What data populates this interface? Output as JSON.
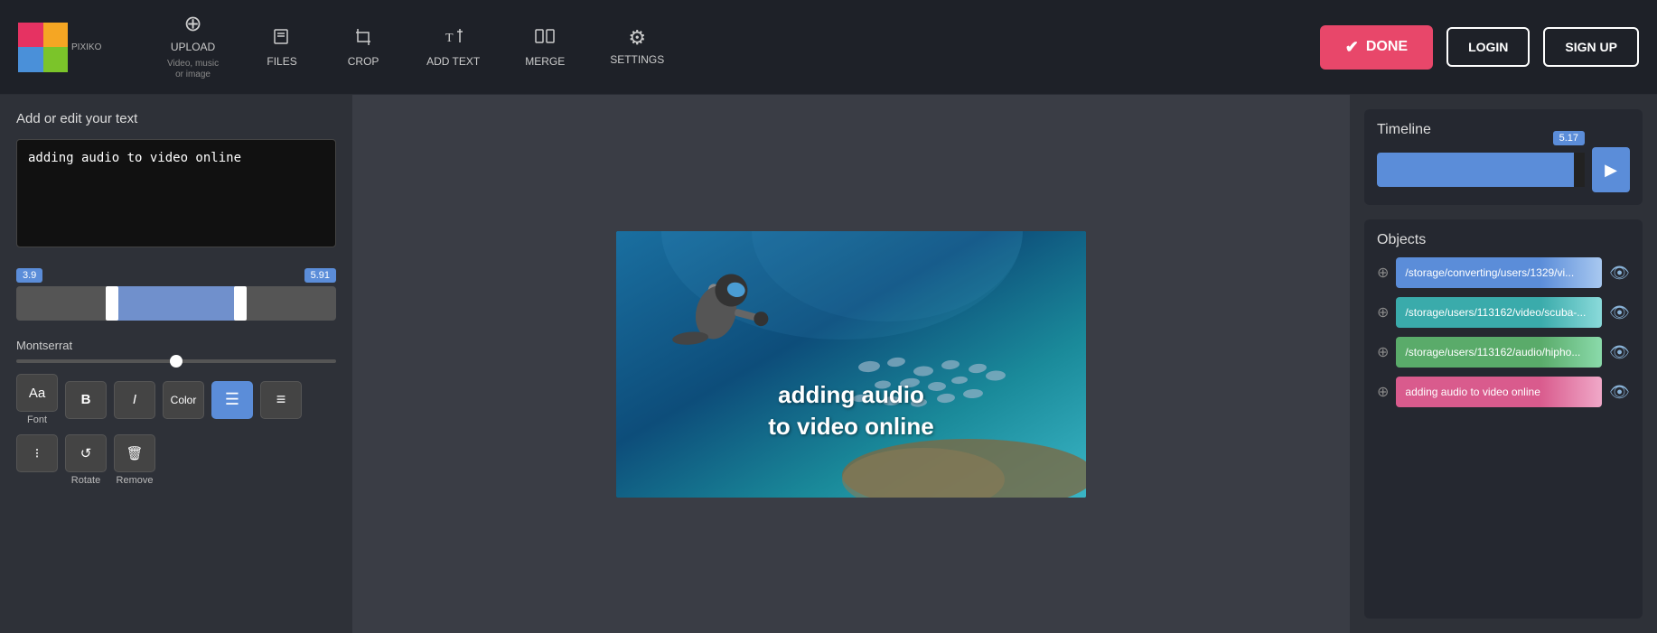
{
  "logo": {
    "alt": "Pixiko"
  },
  "nav": {
    "upload_label": "UPLOAD",
    "upload_sublabel": "Video, music\nor image",
    "files_label": "FILES",
    "crop_label": "CROP",
    "addtext_label": "ADD TEXT",
    "merge_label": "MERGE",
    "settings_label": "SETTINGS",
    "done_label": "DONE",
    "login_label": "LOGIN",
    "signup_label": "SIGN UP"
  },
  "left_panel": {
    "title": "Add or edit your text",
    "text_value": "adding audio to video online",
    "range_start": "3.9",
    "range_end": "5.91",
    "font_name": "Montserrat",
    "font_label": "Font",
    "bold_label": "B",
    "italic_label": "I",
    "color_label": "Color",
    "rotate_label": "Rotate",
    "remove_label": "Remove"
  },
  "video_overlay": {
    "line1": "adding audio",
    "line2": "to video online"
  },
  "right_panel": {
    "timeline_title": "Timeline",
    "timeline_badge": "5.17",
    "objects_title": "Objects",
    "objects": [
      {
        "path": "/storage/converting/users/1329/vi...",
        "color": "blue"
      },
      {
        "path": "/storage/users/113162/video/scuba-...",
        "color": "teal"
      },
      {
        "path": "/storage/users/113162/audio/hipho...",
        "color": "green"
      },
      {
        "path": "adding audio to video online",
        "color": "pink"
      }
    ]
  }
}
